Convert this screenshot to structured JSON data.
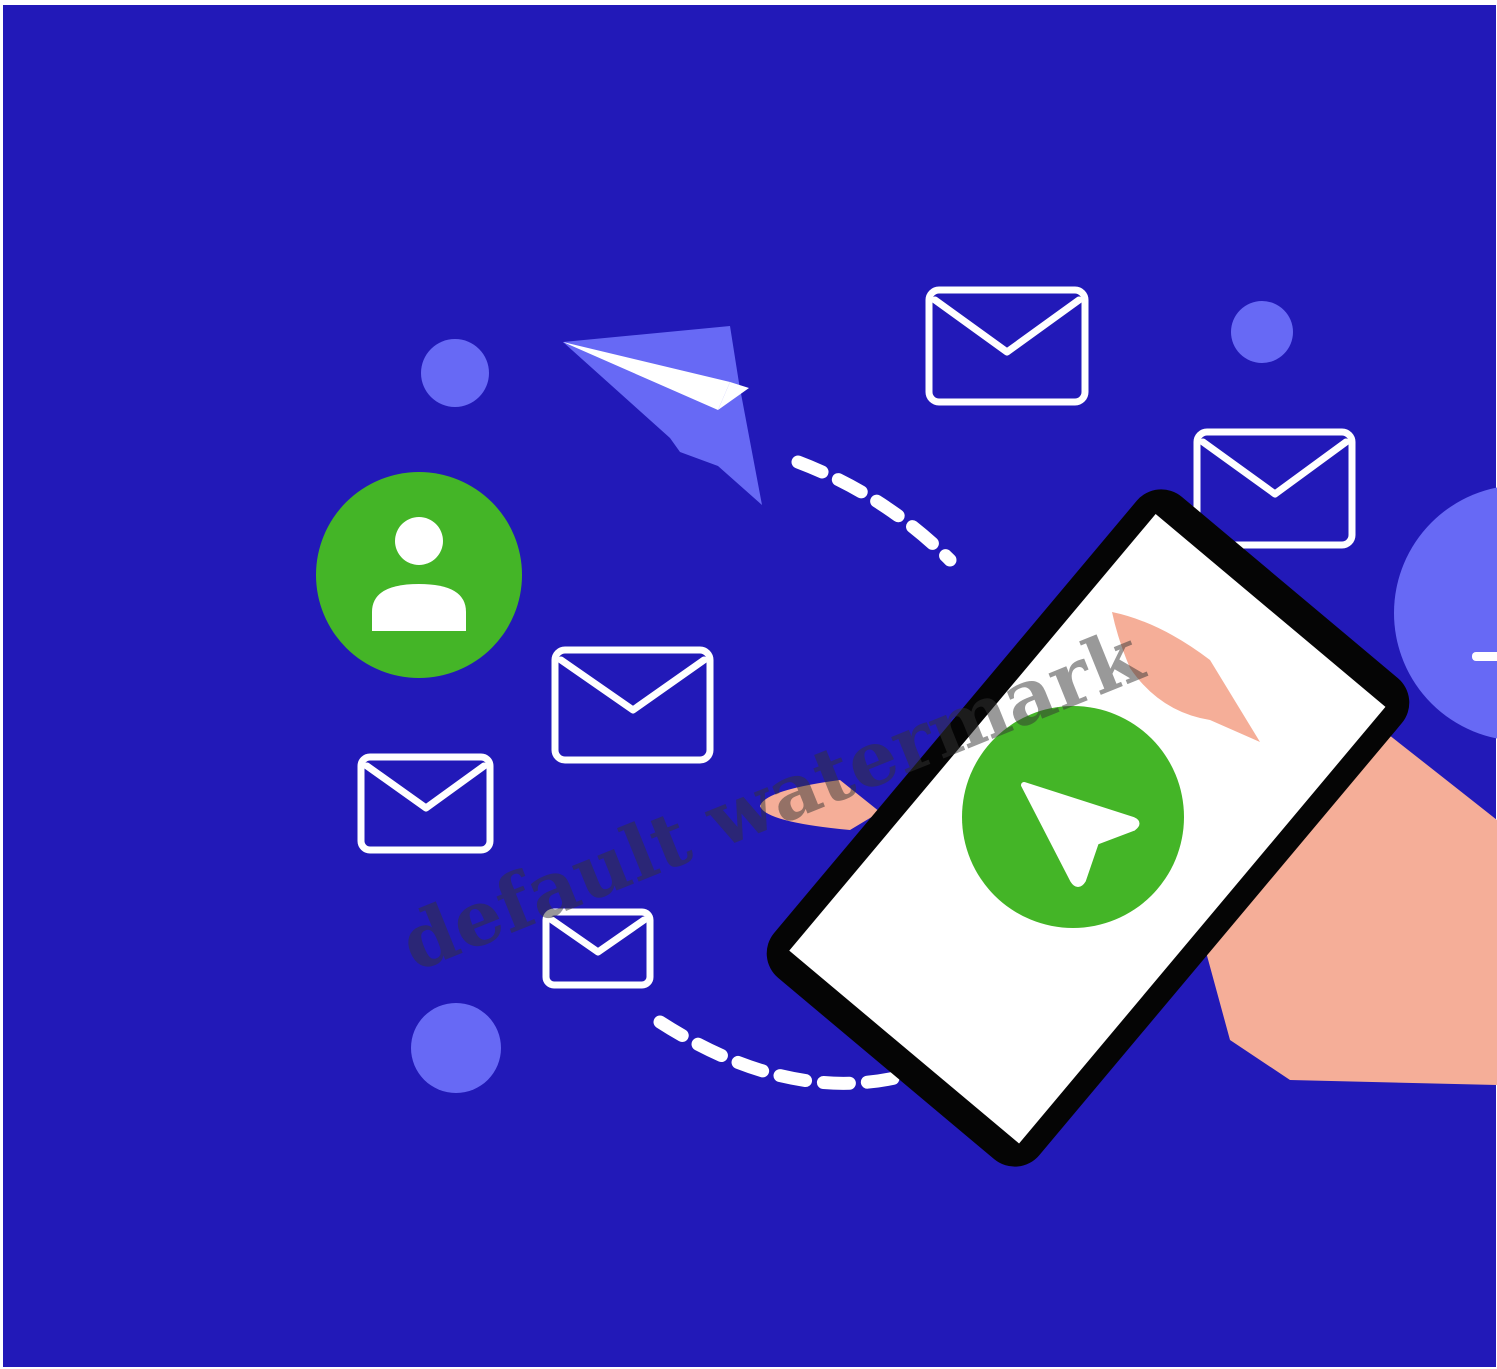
{
  "colors": {
    "background": "#2219B8",
    "accent_light": "#6769F5",
    "green": "#44B527",
    "phone_body": "#050505",
    "screen": "#FFFFFF",
    "hand": "#F5AE98",
    "icon_stroke": "#FFFFFF"
  },
  "icons": {
    "user_avatar": "user-icon",
    "send_button": "send-arrow-icon",
    "paper_plane": "paper-plane-icon",
    "envelope": "envelope-icon"
  },
  "watermark": {
    "text": "default watermark"
  }
}
